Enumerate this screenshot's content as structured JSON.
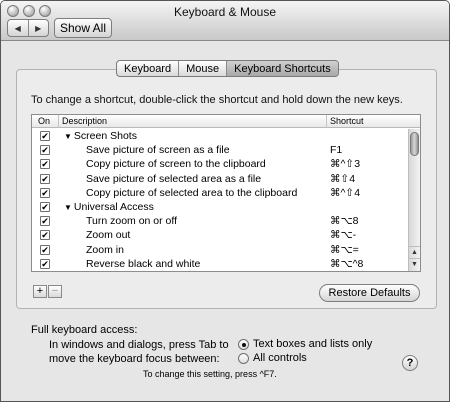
{
  "window": {
    "title": "Keyboard & Mouse"
  },
  "toolbar": {
    "back_icon": "◀",
    "forward_icon": "▶",
    "show_all_label": "Show All"
  },
  "tabs": [
    {
      "label": "Keyboard",
      "active": false
    },
    {
      "label": "Mouse",
      "active": false
    },
    {
      "label": "Keyboard Shortcuts",
      "active": true
    }
  ],
  "instructions": "To change a shortcut, double-click the shortcut and hold down the new keys.",
  "table": {
    "headers": {
      "on": "On",
      "description": "Description",
      "shortcut": "Shortcut"
    },
    "rows": [
      {
        "checked": true,
        "group": true,
        "description": "Screen Shots",
        "shortcut": ""
      },
      {
        "checked": true,
        "group": false,
        "description": "Save picture of screen as a file",
        "shortcut": "F1"
      },
      {
        "checked": true,
        "group": false,
        "description": "Copy picture of screen to the clipboard",
        "shortcut": "⌘^⇧3"
      },
      {
        "checked": true,
        "group": false,
        "description": "Save picture of selected area as a file",
        "shortcut": "⌘⇧4"
      },
      {
        "checked": true,
        "group": false,
        "description": "Copy picture of selected area to the clipboard",
        "shortcut": "⌘^⇧4"
      },
      {
        "checked": true,
        "group": true,
        "description": "Universal Access",
        "shortcut": ""
      },
      {
        "checked": true,
        "group": false,
        "description": "Turn zoom on or off",
        "shortcut": "⌘⌥8"
      },
      {
        "checked": true,
        "group": false,
        "description": "Zoom out",
        "shortcut": "⌘⌥-"
      },
      {
        "checked": true,
        "group": false,
        "description": "Zoom in",
        "shortcut": "⌘⌥="
      },
      {
        "checked": true,
        "group": false,
        "description": "Reverse black and white",
        "shortcut": "⌘⌥^8"
      }
    ]
  },
  "buttons": {
    "add": "+",
    "remove": "−",
    "restore_defaults": "Restore Defaults"
  },
  "keyboard_access": {
    "heading": "Full keyboard access:",
    "description_line1": "In windows and dialogs, press Tab to",
    "description_line2": "move the keyboard focus between:",
    "options": [
      {
        "label": "Text boxes and lists only",
        "selected": true
      },
      {
        "label": "All controls",
        "selected": false
      }
    ],
    "note": "To change this setting, press ^F7."
  },
  "help": {
    "label": "?"
  },
  "icons": {
    "triangle_open": "▼",
    "checkmark": "✔",
    "scroll_up": "▲",
    "scroll_down": "▼"
  }
}
